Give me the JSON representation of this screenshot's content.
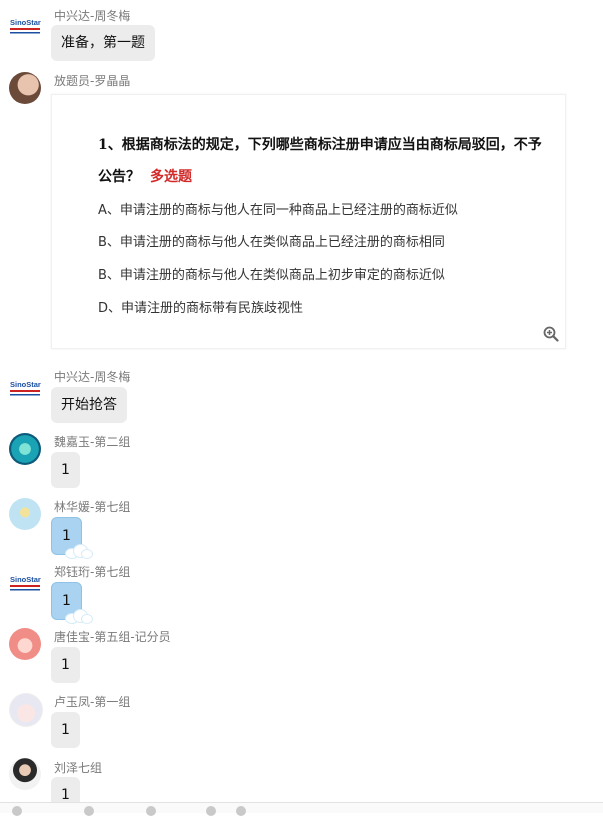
{
  "messages": [
    {
      "sender": "中兴达-周冬梅",
      "text": "准备，第一题"
    },
    {
      "sender": "放题员-罗晶晶"
    },
    {
      "sender": "中兴达-周冬梅",
      "text": "开始抢答"
    },
    {
      "sender": "魏嘉玉-第二组",
      "text": "1"
    },
    {
      "sender": "林华媛-第七组",
      "text": "1"
    },
    {
      "sender": "郑钰珩-第七组",
      "text": "1"
    },
    {
      "sender": "唐佳宝-第五组-记分员",
      "text": "1"
    },
    {
      "sender": "卢玉凤-第一组",
      "text": "1"
    },
    {
      "sender": "刘泽七组",
      "text": "1"
    }
  ],
  "question_card": {
    "title": "1、根据商标法的规定，下列哪些商标注册申请应当由商标局驳回，不予公告？",
    "tag": "多选题",
    "options": [
      "A、申请注册的商标与他人在同一种商品上已经注册的商标近似",
      "B、申请注册的商标与他人在类似商品上已经注册的商标相同",
      "B、申请注册的商标与他人在类似商品上初步审定的商标近似",
      "D、申请注册的商标带有民族歧视性"
    ]
  },
  "logo_text": "SinoStar",
  "icons": {
    "zoom": "zoom-in-icon"
  },
  "colors": {
    "bubble": "#ececec",
    "sticker_bubble": "#a9d3f0",
    "tag": "#d22a2a"
  }
}
